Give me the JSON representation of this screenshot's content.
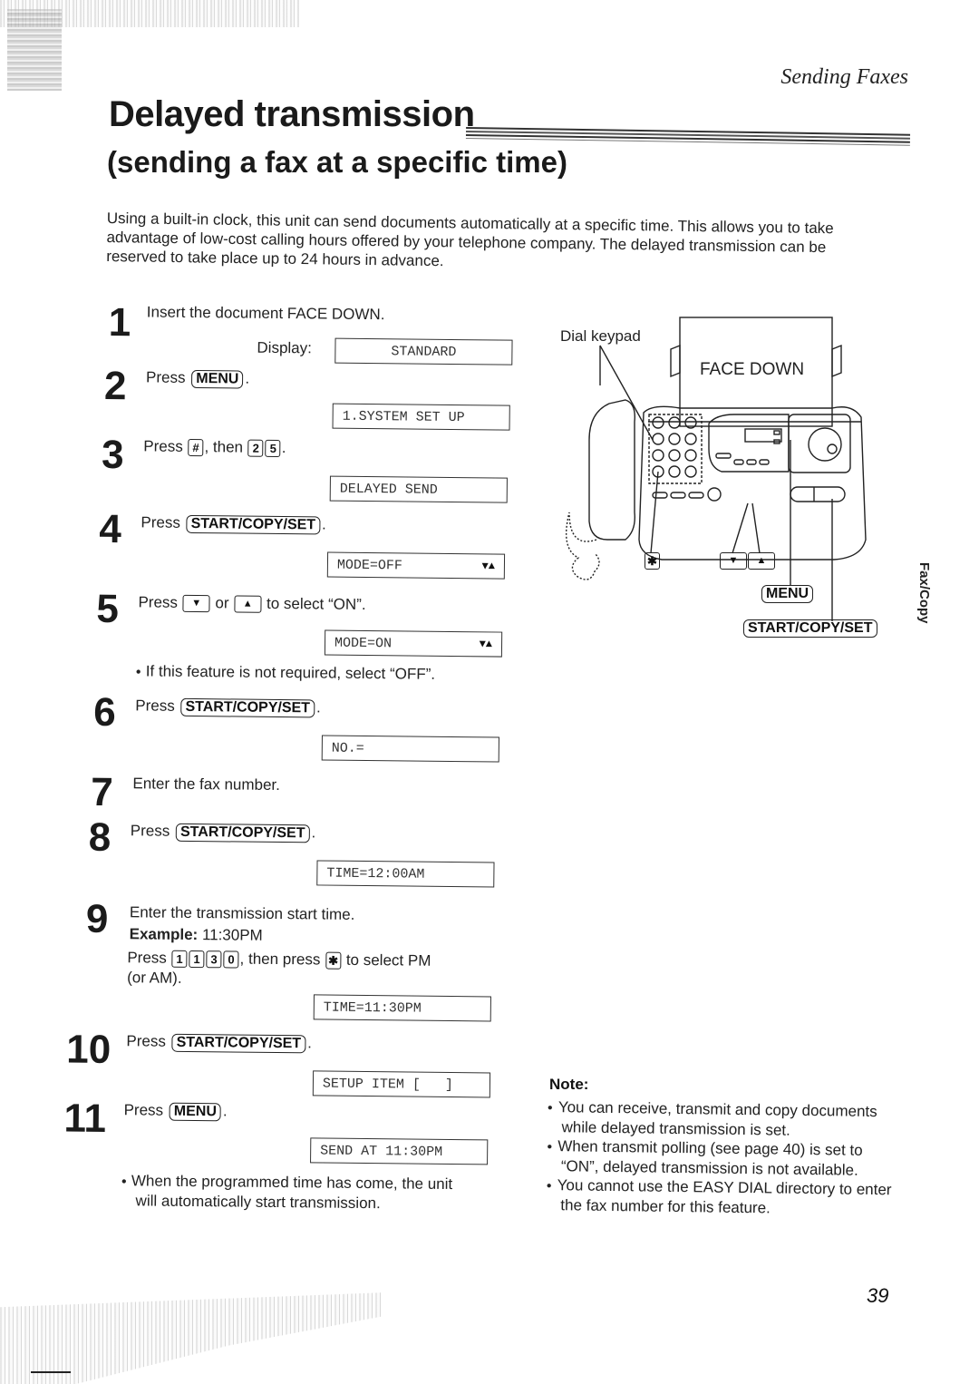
{
  "header": {
    "section": "Sending Faxes",
    "title": "Delayed transmission",
    "subtitle": "(sending a fax at a specific time)"
  },
  "intro": "Using a built-in clock, this unit can send documents automatically at a specific time. This allows you to take advantage of low-cost calling hours offered by your telephone company. The delayed transmission can be reserved to take place up to 24 hours in advance.",
  "steps": [
    {
      "num": "1",
      "text": "Insert the document FACE DOWN.",
      "display_label": "Display:",
      "display": "STANDARD"
    },
    {
      "num": "2",
      "press": "Press",
      "key": "MENU",
      "display": "1.SYSTEM SET UP"
    },
    {
      "num": "3",
      "press": "Press",
      "key1": "#",
      "then": ", then",
      "key2": "2",
      "key3": "5",
      "display": "DELAYED SEND"
    },
    {
      "num": "4",
      "press": "Press",
      "key": "START/COPY/SET",
      "display": "MODE=OFF",
      "display_arrows": "▼▲"
    },
    {
      "num": "5",
      "press": "Press",
      "key1": "▼",
      "or": "or",
      "key2": "▲",
      "rest": "to select “ON”.",
      "display": "MODE=ON",
      "display_arrows": "▼▲",
      "bullet": "If this feature is not required, select “OFF”."
    },
    {
      "num": "6",
      "press": "Press",
      "key": "START/COPY/SET",
      "display": "NO.="
    },
    {
      "num": "7",
      "text": "Enter the fax number."
    },
    {
      "num": "8",
      "press": "Press",
      "key": "START/COPY/SET",
      "display": "TIME=12:00AM"
    },
    {
      "num": "9",
      "text": "Enter the transmission start time.",
      "example_label": "Example:",
      "example_value": "11:30PM",
      "press": "Press",
      "keys": [
        "1",
        "1",
        "3",
        "0"
      ],
      "then_press": ", then press",
      "star_key": "✱",
      "rest": "to select PM",
      "rest2": "(or AM).",
      "display": "TIME=11:30PM"
    },
    {
      "num": "10",
      "press": "Press",
      "key": "START/COPY/SET",
      "display": "SETUP ITEM [   ]"
    },
    {
      "num": "11",
      "press": "Press",
      "key": "MENU",
      "display": "SEND AT 11:30PM",
      "bullet_line1": "When the programmed time has come, the unit",
      "bullet_line2": "will automatically start transmission."
    }
  ],
  "note": {
    "title": "Note:",
    "items": [
      "You can receive, transmit and copy documents while delayed transmission is set.",
      "When transmit polling (see page 40) is set to “ON”, delayed transmission is not available.",
      "You cannot use the EASY DIAL directory to enter the fax number for this feature."
    ]
  },
  "figure": {
    "dial_keypad_label": "Dial keypad",
    "paper_label": "FACE DOWN",
    "star_key": "✱",
    "down_key": "▼",
    "up_key": "▲",
    "menu_key": "MENU",
    "start_key": "START/COPY/SET"
  },
  "side_tab": "Fax/Copy",
  "page_number": "39"
}
